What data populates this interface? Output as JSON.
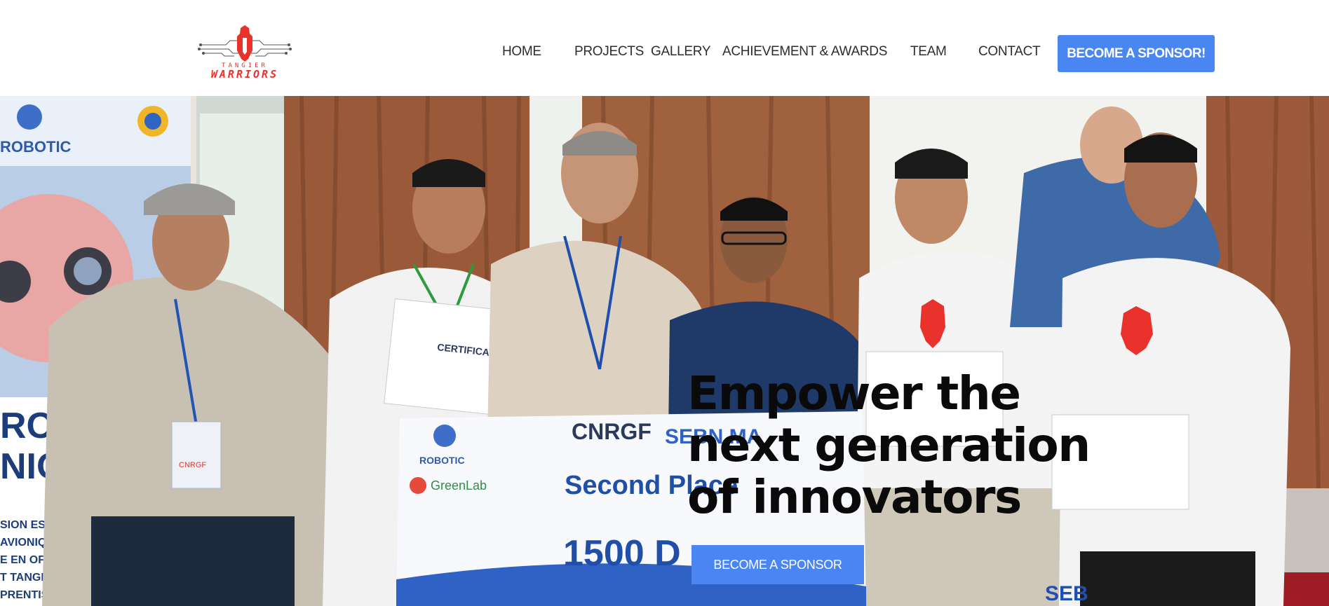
{
  "logo": {
    "alt": "Tangier Warriors",
    "top_text": "TANGIER",
    "main_text": "WARRIORS",
    "brand_color": "#e8322b"
  },
  "nav": {
    "items": [
      {
        "label": "HOME"
      },
      {
        "label": "PROJECTS"
      },
      {
        "label": "GALLERY"
      },
      {
        "label": "ACHIEVEMENT & AWARDS"
      },
      {
        "label": "TEAM"
      },
      {
        "label": "CONTACT"
      }
    ],
    "cta_label": "BECOME A SPONSOR!"
  },
  "hero": {
    "title": "Empower the next generation of innovators",
    "cta_label": "BECOME A SPONSOR",
    "accent_color": "#4a86f2",
    "photo": {
      "banner_brand": "ROBOTIC",
      "banner_text_lines": [
        "ROB",
        "NIQU",
        "SION EST DE PRO",
        "AVIONIQUE ET L",
        "E EN OFFRANT A",
        "T TANGER  UNE F",
        "PRENTISSAGE PR"
      ],
      "cheque_logo": "ROBOTIC",
      "cheque_partner": "GreenLab",
      "cheque_org_1": "CNRGF",
      "cheque_org_2": "SEBN.MA",
      "cheque_prize": "Second Place",
      "cheque_amount": "1500 D",
      "certificate_label": "CERTIFICAT",
      "bottom_brand": "SEB",
      "badge_text": "CNRGF"
    }
  }
}
